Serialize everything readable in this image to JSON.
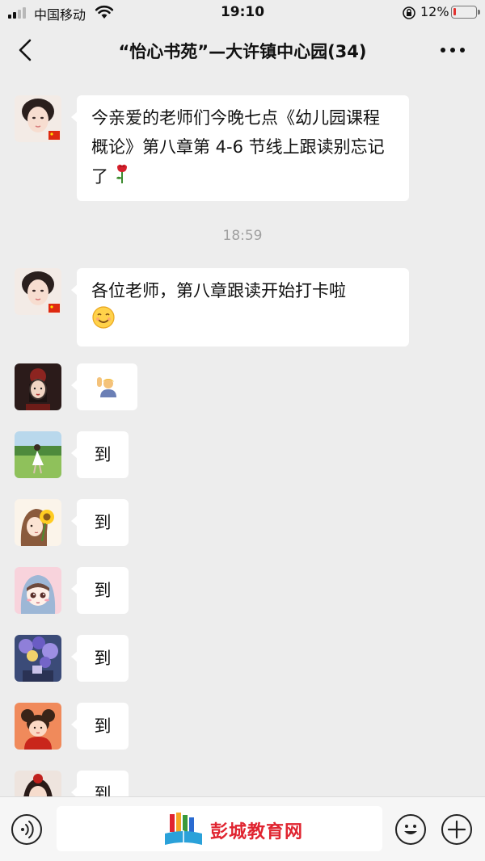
{
  "status_bar": {
    "carrier": "中国移动",
    "time": "19:10",
    "battery_percent": "12%",
    "battery_level": 0.12
  },
  "nav": {
    "title": "“怡心书苑”—大许镇中心园(34)",
    "back_icon": "chevron-left-icon",
    "more_icon": "more-dots-icon"
  },
  "messages": [
    {
      "type": "text",
      "text": "今亲爱的老师们今晚七点《幼儿园课程概论》第八章第 4-6 节线上跟读别忘记了",
      "emoji": "rose"
    },
    {
      "type": "timestamp",
      "text": "18:59"
    },
    {
      "type": "text",
      "text": "各位老师，第八章跟读开始打卡啦",
      "emoji": "smiling-face"
    },
    {
      "type": "emoji",
      "emoji": "person-raising-hand"
    },
    {
      "type": "text",
      "text": "到"
    },
    {
      "type": "text",
      "text": "到"
    },
    {
      "type": "text",
      "text": "到"
    },
    {
      "type": "text",
      "text": "到"
    },
    {
      "type": "text",
      "text": "到"
    },
    {
      "type": "text",
      "text": "到"
    }
  ],
  "input_bar": {
    "watermark": "彭城教育网",
    "voice_icon": "voice-icon",
    "emoji_icon": "emoji-face-icon",
    "plus_icon": "plus-icon"
  },
  "colors": {
    "background": "#ededed",
    "bubble": "#ffffff",
    "timestamp": "#a0a0a0",
    "battery_low": "#e2322f",
    "watermark": "#e02430"
  }
}
